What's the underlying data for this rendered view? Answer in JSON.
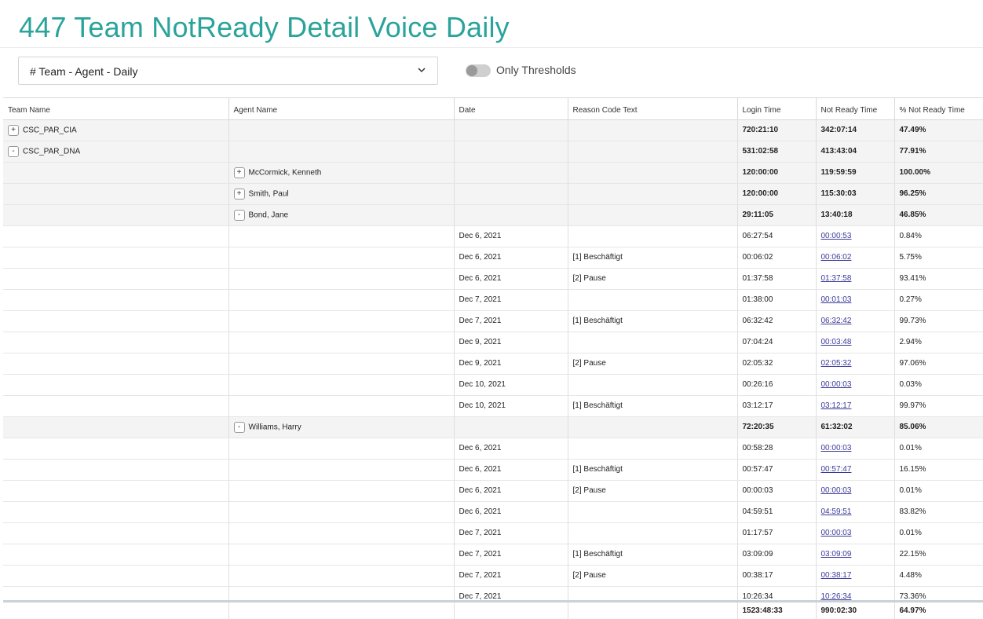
{
  "page": {
    "title": "447 Team NotReady Detail Voice Daily"
  },
  "controls": {
    "view_select": {
      "value": "# Team - Agent - Daily"
    },
    "thresholds_toggle": {
      "label": "Only Thresholds",
      "on": false
    }
  },
  "table": {
    "columns": [
      "Team Name",
      "Agent Name",
      "Date",
      "Reason Code Text",
      "Login Time",
      "Not Ready Time",
      "% Not Ready Time"
    ],
    "rows": [
      {
        "type": "team",
        "expander": "+",
        "team": "CSC_PAR_CIA",
        "agent": "",
        "date": "",
        "reason": "",
        "login": "720:21:10",
        "notready": "342:07:14",
        "pct": "47.49%"
      },
      {
        "type": "team",
        "expander": "-",
        "team": "CSC_PAR_DNA",
        "agent": "",
        "date": "",
        "reason": "",
        "login": "531:02:58",
        "notready": "413:43:04",
        "pct": "77.91%"
      },
      {
        "type": "agent",
        "expander": "+",
        "team": "",
        "agent": "McCormick, Kenneth",
        "date": "",
        "reason": "",
        "login": "120:00:00",
        "notready": "119:59:59",
        "pct": "100.00%"
      },
      {
        "type": "agent",
        "expander": "+",
        "team": "",
        "agent": "Smith, Paul",
        "date": "",
        "reason": "",
        "login": "120:00:00",
        "notready": "115:30:03",
        "pct": "96.25%"
      },
      {
        "type": "agent",
        "expander": "-",
        "team": "",
        "agent": "Bond, Jane",
        "date": "",
        "reason": "",
        "login": "29:11:05",
        "notready": "13:40:18",
        "pct": "46.85%"
      },
      {
        "type": "detail",
        "team": "",
        "agent": "",
        "date": "Dec 6, 2021",
        "reason": "",
        "login": "06:27:54",
        "notready": "00:00:53",
        "pct": "0.84%"
      },
      {
        "type": "detail",
        "team": "",
        "agent": "",
        "date": "Dec 6, 2021",
        "reason": "[1] Beschäftigt",
        "login": "00:06:02",
        "notready": "00:06:02",
        "pct": "5.75%"
      },
      {
        "type": "detail",
        "team": "",
        "agent": "",
        "date": "Dec 6, 2021",
        "reason": "[2] Pause",
        "login": "01:37:58",
        "notready": "01:37:58",
        "pct": "93.41%"
      },
      {
        "type": "detail",
        "team": "",
        "agent": "",
        "date": "Dec 7, 2021",
        "reason": "",
        "login": "01:38:00",
        "notready": "00:01:03",
        "pct": "0.27%"
      },
      {
        "type": "detail",
        "team": "",
        "agent": "",
        "date": "Dec 7, 2021",
        "reason": "[1] Beschäftigt",
        "login": "06:32:42",
        "notready": "06:32:42",
        "pct": "99.73%"
      },
      {
        "type": "detail",
        "team": "",
        "agent": "",
        "date": "Dec 9, 2021",
        "reason": "",
        "login": "07:04:24",
        "notready": "00:03:48",
        "pct": "2.94%"
      },
      {
        "type": "detail",
        "team": "",
        "agent": "",
        "date": "Dec 9, 2021",
        "reason": "[2] Pause",
        "login": "02:05:32",
        "notready": "02:05:32",
        "pct": "97.06%"
      },
      {
        "type": "detail",
        "team": "",
        "agent": "",
        "date": "Dec 10, 2021",
        "reason": "",
        "login": "00:26:16",
        "notready": "00:00:03",
        "pct": "0.03%"
      },
      {
        "type": "detail",
        "team": "",
        "agent": "",
        "date": "Dec 10, 2021",
        "reason": "[1] Beschäftigt",
        "login": "03:12:17",
        "notready": "03:12:17",
        "pct": "99.97%"
      },
      {
        "type": "agent",
        "expander": "-",
        "team": "",
        "agent": "Williams, Harry",
        "date": "",
        "reason": "",
        "login": "72:20:35",
        "notready": "61:32:02",
        "pct": "85.06%"
      },
      {
        "type": "detail",
        "team": "",
        "agent": "",
        "date": "Dec 6, 2021",
        "reason": "",
        "login": "00:58:28",
        "notready": "00:00:03",
        "pct": "0.01%"
      },
      {
        "type": "detail",
        "team": "",
        "agent": "",
        "date": "Dec 6, 2021",
        "reason": "[1] Beschäftigt",
        "login": "00:57:47",
        "notready": "00:57:47",
        "pct": "16.15%"
      },
      {
        "type": "detail",
        "team": "",
        "agent": "",
        "date": "Dec 6, 2021",
        "reason": "[2] Pause",
        "login": "00:00:03",
        "notready": "00:00:03",
        "pct": "0.01%"
      },
      {
        "type": "detail",
        "team": "",
        "agent": "",
        "date": "Dec 6, 2021",
        "reason": "",
        "login": "04:59:51",
        "notready": "04:59:51",
        "pct": "83.82%"
      },
      {
        "type": "detail",
        "team": "",
        "agent": "",
        "date": "Dec 7, 2021",
        "reason": "",
        "login": "01:17:57",
        "notready": "00:00:03",
        "pct": "0.01%"
      },
      {
        "type": "detail",
        "team": "",
        "agent": "",
        "date": "Dec 7, 2021",
        "reason": "[1] Beschäftigt",
        "login": "03:09:09",
        "notready": "03:09:09",
        "pct": "22.15%"
      },
      {
        "type": "detail",
        "team": "",
        "agent": "",
        "date": "Dec 7, 2021",
        "reason": "[2] Pause",
        "login": "00:38:17",
        "notready": "00:38:17",
        "pct": "4.48%"
      },
      {
        "type": "detail",
        "team": "",
        "agent": "",
        "date": "Dec 7, 2021",
        "reason": "",
        "login": "10:26:34",
        "notready": "10:26:34",
        "pct": "73.36%"
      }
    ],
    "totals": {
      "login": "1523:48:33",
      "notready": "990:02:30",
      "pct": "64.97%"
    }
  }
}
